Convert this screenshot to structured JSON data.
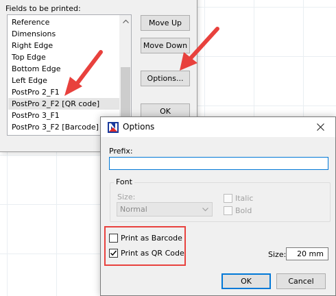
{
  "background_dialog": {
    "fields_label": "Fields to be printed:",
    "fields": [
      "Reference",
      "Dimensions",
      "Right Edge",
      "Top Edge",
      "Bottom Edge",
      "Left Edge",
      "PostPro 2_F1",
      "PostPro 2_F2 [QR code]",
      "PostPro 3_F1",
      "PostPro 3_F2 [Barcode]"
    ],
    "selected_field": "PostPro 2_F2 [QR code]",
    "buttons": {
      "move_up": "Move Up",
      "move_down": "Move Down",
      "options": "Options...",
      "ok": "OK"
    }
  },
  "options_dialog": {
    "title": "Options",
    "prefix_label": "Prefix:",
    "prefix_value": "",
    "font_group": {
      "legend": "Font",
      "size_label": "Size:",
      "size_value": "Normal",
      "italic_label": "Italic",
      "italic_checked": false,
      "bold_label": "Bold",
      "bold_checked": false
    },
    "print_as_barcode_label": "Print as Barcode",
    "print_as_barcode_checked": false,
    "print_as_qr_label": "Print as QR Code",
    "print_as_qr_checked": true,
    "size_label": "Size:",
    "size_value": "20 mm",
    "ok_label": "OK",
    "cancel_label": "Cancel"
  },
  "colors": {
    "annotation_red": "#e8413d",
    "focus_blue": "#0078d7"
  }
}
